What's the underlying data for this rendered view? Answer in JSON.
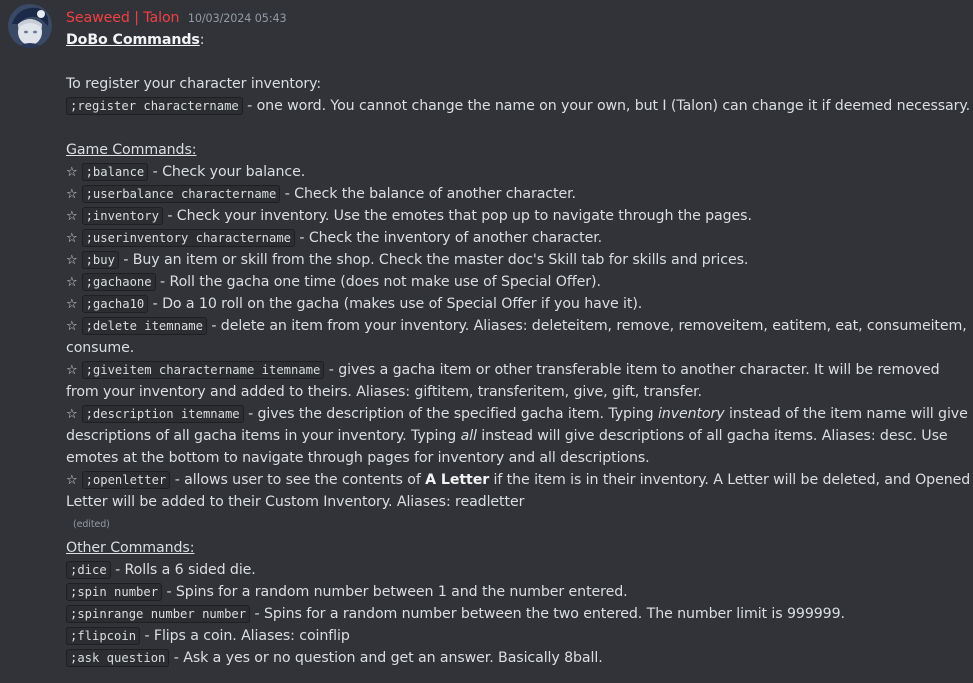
{
  "message": {
    "author": "Seaweed | Talon",
    "timestamp": "10/03/2024 05:43",
    "title": "DoBo Commands",
    "title_suffix": ":",
    "register_intro": "To register your character inventory:",
    "register_cmd": ";register charactername",
    "register_desc": " - one word. You cannot change the name on your own, but I (Talon) can change it if deemed necessary.",
    "game_heading": "Game Commands:",
    "game": [
      {
        "cmd": ";balance",
        "desc": " - Check your balance."
      },
      {
        "cmd": ";userbalance charactername",
        "desc": " - Check the balance of another character."
      },
      {
        "cmd": ";inventory",
        "desc": " - Check your inventory. Use the emotes that pop up to navigate through the pages."
      },
      {
        "cmd": ";userinventory charactername",
        "desc": " - Check the inventory of another character."
      },
      {
        "cmd": ";buy",
        "desc": " - Buy an item or skill from the shop. Check the master doc's Skill tab for skills and prices."
      },
      {
        "cmd": ";gachaone",
        "desc": " - Roll the gacha one time (does not make use of Special Offer)."
      },
      {
        "cmd": ";gacha10",
        "desc": " - Do a 10 roll on the gacha (makes use of Special Offer if you have it)."
      },
      {
        "cmd": ";delete itemname",
        "desc": " - delete an item from your inventory. Aliases: deleteitem, remove, removeitem, eatitem, eat, consumeitem,",
        "desc2": "consume."
      },
      {
        "cmd": ";giveitem charactername itemname",
        "desc": " - gives a gacha item or other transferable item to another character. It will be removed",
        "desc2": "from your inventory and added to theirs. Aliases: giftitem, transferitem, give, gift, transfer."
      }
    ],
    "description_cmd": ";description itemname",
    "description_a": " - gives the description of the specified gacha item. Typing ",
    "description_em1": "inventory",
    "description_b": " instead of the item name will give",
    "description_c": "descriptions of all gacha items in your inventory. Typing ",
    "description_em2": "all",
    "description_d": " instead will give descriptions of all gacha items. Aliases: desc. Use",
    "description_e": "emotes at the bottom to navigate through pages for inventory and all descriptions.",
    "openletter_cmd": ";openletter",
    "openletter_a": " - allows user to see the contents of ",
    "openletter_strong": "A Letter",
    "openletter_b": " if the item is in their inventory. A Letter will be deleted, and Opened",
    "openletter_c": "Letter will be added to their Custom Inventory. Aliases: readletter",
    "edited": "(edited)",
    "other_heading": "Other Commands:",
    "other": [
      {
        "cmd": ";dice",
        "desc": " - Rolls a 6 sided die."
      },
      {
        "cmd": ";spin number",
        "desc": " - Spins for a random number between 1 and the number entered."
      },
      {
        "cmd": ";spinrange number number",
        "desc": " - Spins for a random number between the two entered. The number limit is 999999."
      },
      {
        "cmd": ";flipcoin",
        "desc": " - Flips a coin. Aliases: coinflip"
      },
      {
        "cmd": ";ask question",
        "desc": " - Ask a yes or no question and get an answer. Basically 8ball."
      }
    ],
    "star": "☆",
    "colors": {
      "author": "#f23f43",
      "background": "#313338",
      "code_bg": "#2b2d31"
    }
  }
}
